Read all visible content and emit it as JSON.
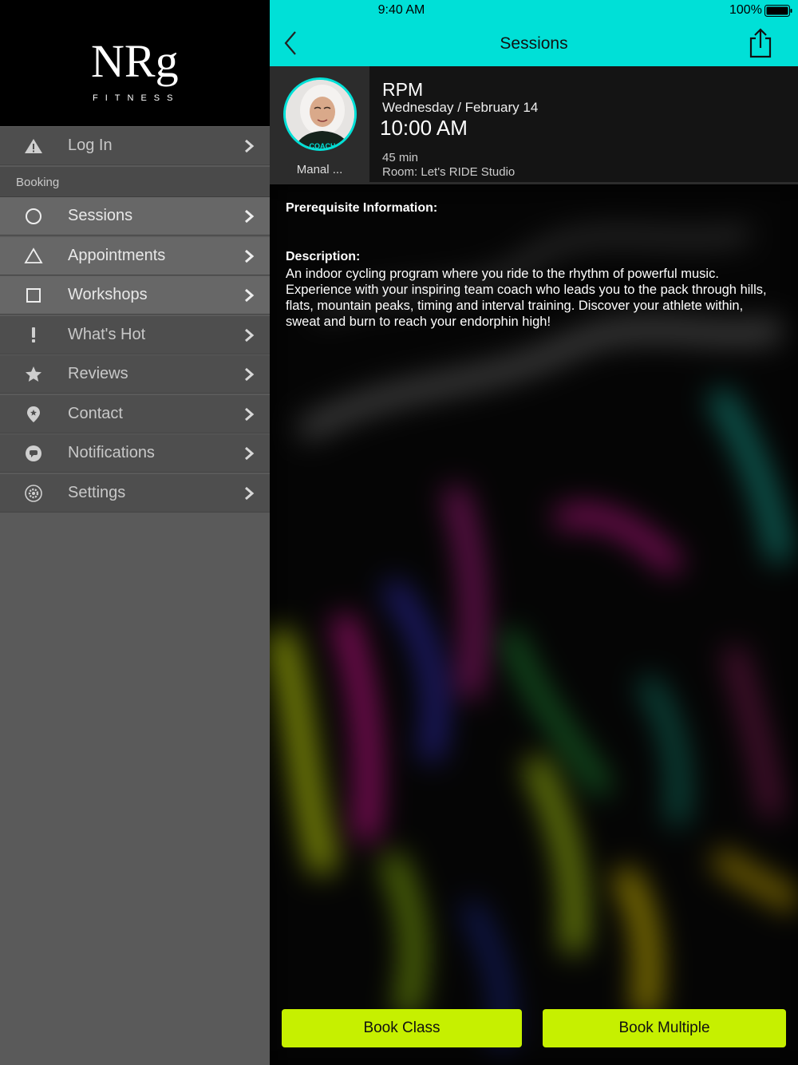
{
  "brand": {
    "logo_letters": "NRg",
    "logo_subtitle": "FITNESS"
  },
  "sidebar": {
    "login_label": "Log In",
    "section_booking": "Booking",
    "items": [
      {
        "label": "Sessions",
        "icon": "circle-icon"
      },
      {
        "label": "Appointments",
        "icon": "triangle-icon"
      },
      {
        "label": "Workshops",
        "icon": "square-icon"
      },
      {
        "label": "What's Hot",
        "icon": "exclamation-icon"
      },
      {
        "label": "Reviews",
        "icon": "star-icon"
      },
      {
        "label": "Contact",
        "icon": "location-pin-icon"
      },
      {
        "label": "Notifications",
        "icon": "chat-bubble-icon"
      },
      {
        "label": "Settings",
        "icon": "gear-icon"
      }
    ]
  },
  "status_bar": {
    "time": "9:40 AM",
    "battery": "100%"
  },
  "nav": {
    "title": "Sessions"
  },
  "session": {
    "coach_name": "Manal ...",
    "coach_shirt_text": "COACH",
    "class_name": "RPM",
    "date": "Wednesday / February 14",
    "time": "10:00 AM",
    "duration": "45 min",
    "room": "Room: Let's RIDE Studio",
    "prereq_title": "Prerequisite Information:",
    "description_title": "Description:",
    "description": "An indoor cycling program where you ride to the rhythm of powerful music. Experience with your inspiring team coach who leads you to the pack through hills, flats, mountain peaks, timing and interval training. Discover your athlete within, sweat and burn to reach your endorphin high!"
  },
  "actions": {
    "book_class": "Book Class",
    "book_multiple": "Book Multiple"
  },
  "colors": {
    "accent": "#00e0d7",
    "button": "#c6f000",
    "sidebar": "#5a5a5a"
  }
}
